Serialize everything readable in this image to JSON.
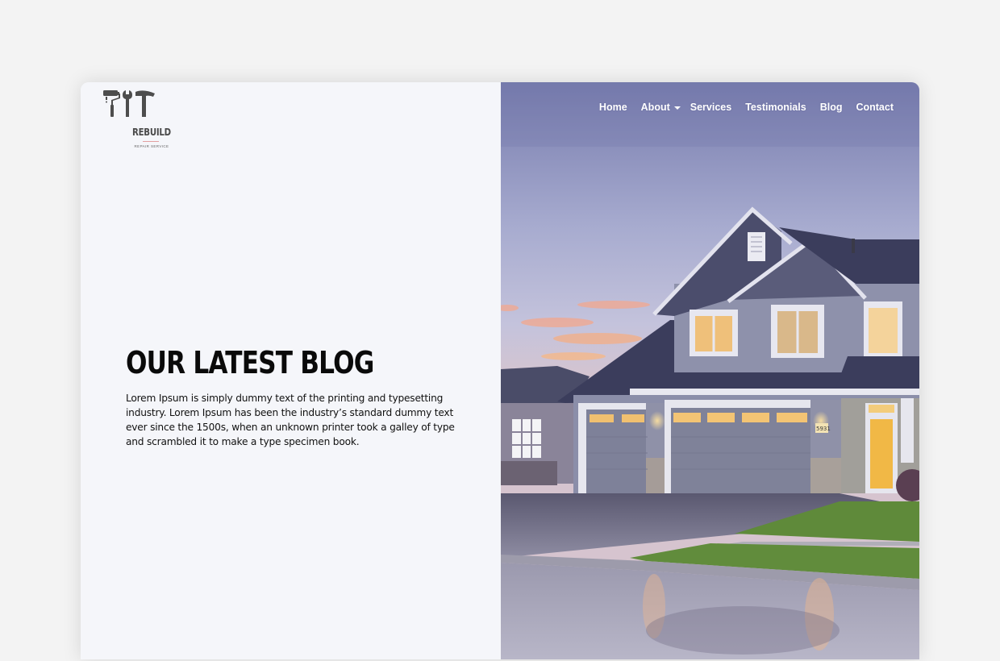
{
  "brand": {
    "name": "REBUILD",
    "tagline": "REPAIR SERVICE",
    "logo_icons": [
      "paint-roller-icon",
      "wrench-icon",
      "hammer-icon"
    ]
  },
  "nav": {
    "items": [
      {
        "label": "Home",
        "has_dropdown": false
      },
      {
        "label": "About",
        "has_dropdown": true
      },
      {
        "label": "Services",
        "has_dropdown": false
      },
      {
        "label": "Testimonials",
        "has_dropdown": false
      },
      {
        "label": "Blog",
        "has_dropdown": false
      },
      {
        "label": "Contact",
        "has_dropdown": false
      }
    ]
  },
  "hero": {
    "title": "OUR LATEST BLOG",
    "description": "Lorem Ipsum is simply dummy text of the printing and typesetting industry. Lorem Ipsum has been the industry’s standard dummy text ever since the 1500s, when an unknown printer took a galley of type and scrambled it to make a type specimen book.",
    "image_alt": "Two-story gray house with double garage at dusk, wet driveway and lawn",
    "house_number": "5931"
  },
  "colors": {
    "page_bg": "#f3f3f3",
    "panel_bg": "#f5f6fa",
    "heading": "#0a0a0a",
    "nav_text": "#ffffff",
    "sky_top": "#7a7fb0",
    "roof": "#3b3d5c",
    "siding": "#8f93ad",
    "window_glow": "#f2c26a",
    "grass": "#5f8a3a"
  }
}
